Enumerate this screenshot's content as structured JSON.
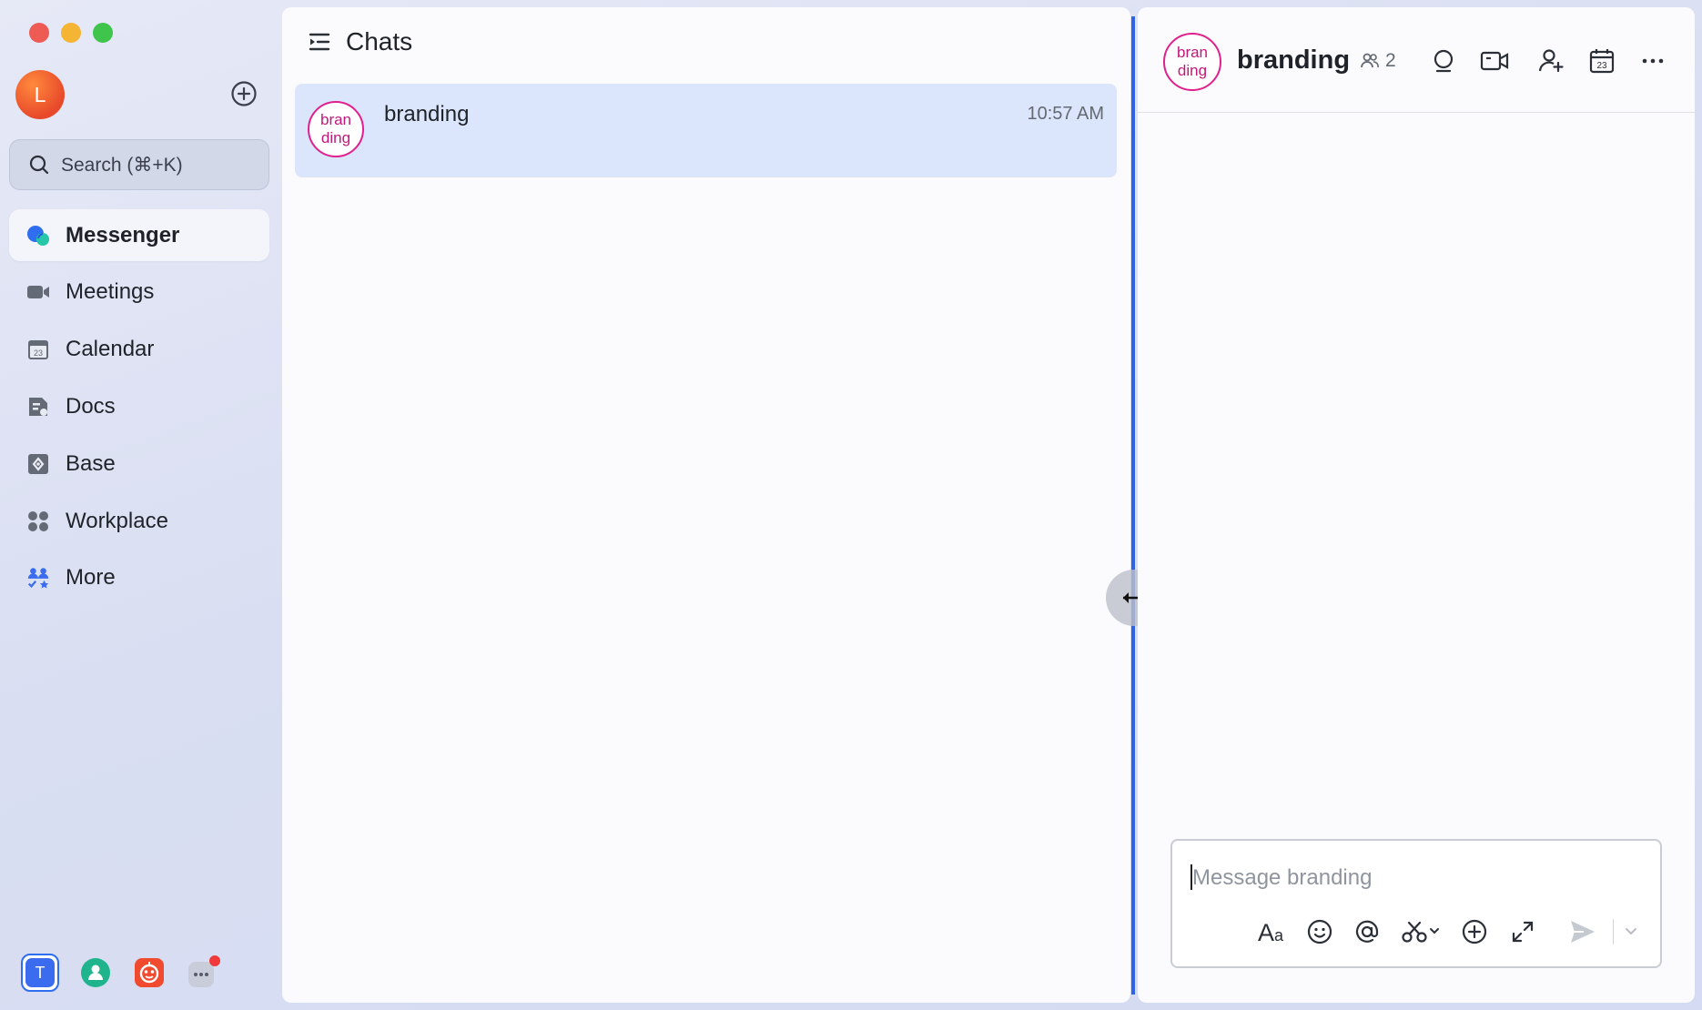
{
  "window": {
    "traffic_lights": [
      "#ee5b55",
      "#f5b534",
      "#3fc44c"
    ]
  },
  "sidebar": {
    "avatar_initial": "L",
    "search_placeholder": "Search (⌘+K)",
    "items": [
      {
        "label": "Messenger",
        "icon": "messenger-icon",
        "active": true
      },
      {
        "label": "Meetings",
        "icon": "video-camera-icon"
      },
      {
        "label": "Calendar",
        "icon": "calendar-icon"
      },
      {
        "label": "Docs",
        "icon": "docs-icon"
      },
      {
        "label": "Base",
        "icon": "base-icon"
      },
      {
        "label": "Workplace",
        "icon": "grid-icon"
      },
      {
        "label": "More",
        "icon": "more-apps-icon"
      }
    ],
    "dock": {
      "tenant_initial": "T"
    }
  },
  "chat_list": {
    "title": "Chats",
    "items": [
      {
        "name": "branding",
        "badge_line1": "bran",
        "badge_line2": "ding",
        "time": "10:57 AM",
        "selected": true
      }
    ]
  },
  "conversation": {
    "title": "branding",
    "badge_line1": "bran",
    "badge_line2": "ding",
    "member_count": "2",
    "composer_placeholder": "Message branding"
  },
  "colors": {
    "accent": "#2e63e6",
    "badge": "#e0208f",
    "selected_row": "#dbe5fb"
  }
}
